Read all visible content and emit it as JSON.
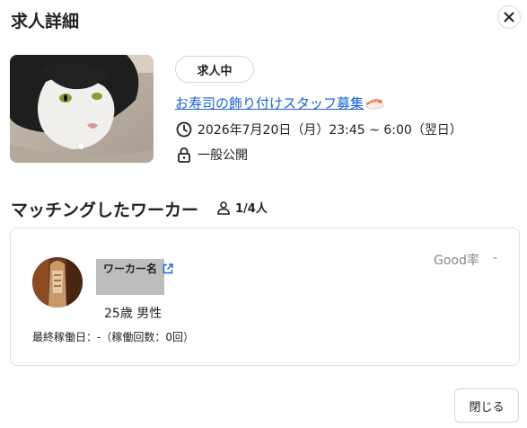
{
  "dialog": {
    "title": "求人詳細",
    "close_label": "閉じる"
  },
  "job": {
    "status": "求人中",
    "title": "お寿司の飾り付けスタッフ募集",
    "datetime": "2026年7月20日（月）23:45 ~ 6:00（翌日）",
    "visibility": "一般公開",
    "link_color": "#1a63d6"
  },
  "matching": {
    "title": "マッチングしたワーカー",
    "count": "1/4人"
  },
  "worker": {
    "name_label": "ワーカー名",
    "age_sex": "25歳 男性",
    "last_work": "最終稼働日：-（稼働回数：0回）",
    "good_rate_label": "Good率",
    "good_rate_value": "-"
  }
}
